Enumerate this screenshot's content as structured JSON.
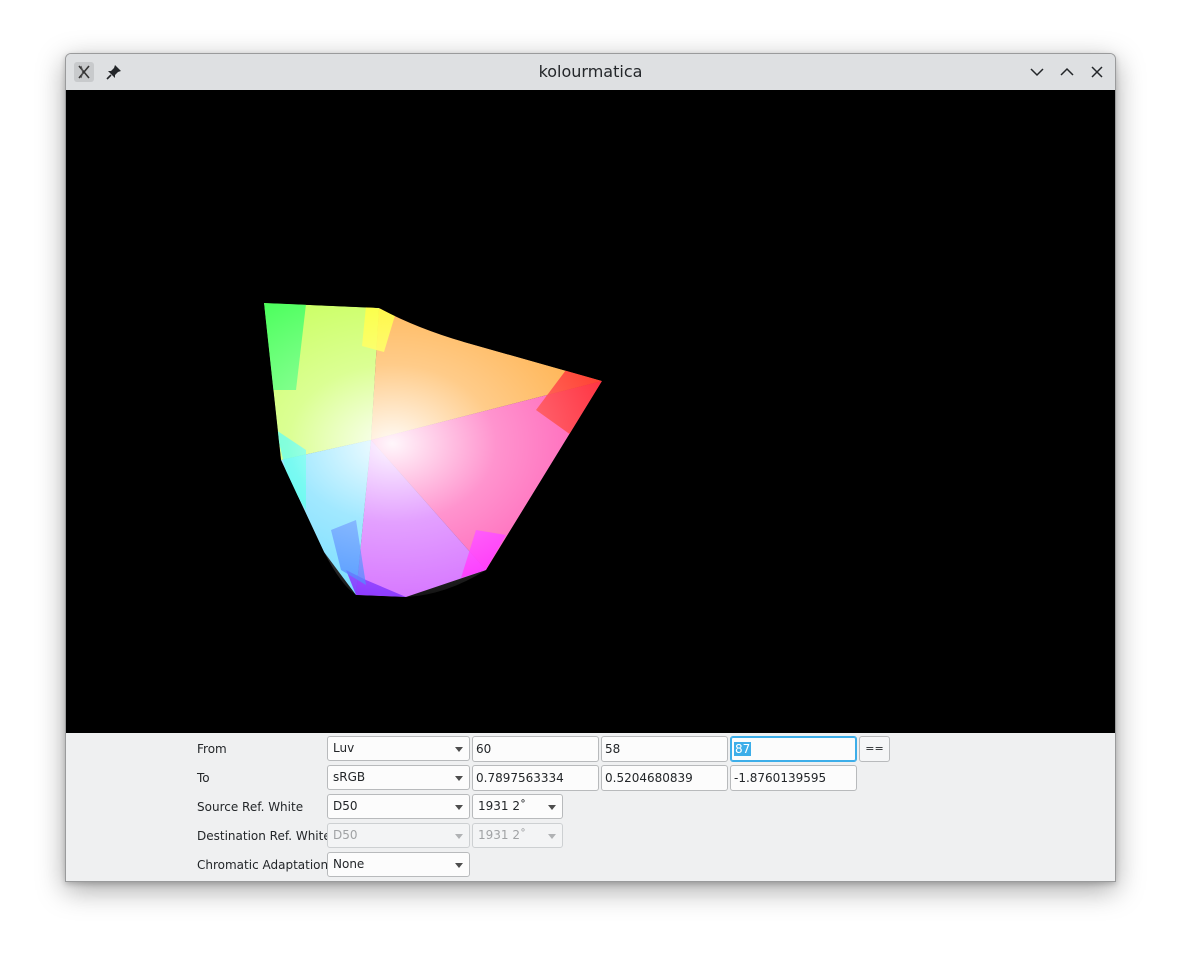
{
  "window": {
    "title": "kolourmatica"
  },
  "form": {
    "from": {
      "label": "From",
      "space": "Luv",
      "values": [
        "60",
        "58"
      ],
      "third_value": "87",
      "apply_label": "=="
    },
    "to": {
      "label": "To",
      "space": "sRGB",
      "values": [
        "0.7897563334",
        "0.5204680839",
        "-1.8760139595"
      ]
    },
    "source_white": {
      "label": "Source Ref. White",
      "illuminant": "D50",
      "observer": "1931 2˚"
    },
    "dest_white": {
      "label": "Destination Ref. White",
      "illuminant": "D50",
      "observer": "1931 2˚"
    },
    "chromatic": {
      "label": "Chromatic Adaptation",
      "method": "None"
    }
  }
}
